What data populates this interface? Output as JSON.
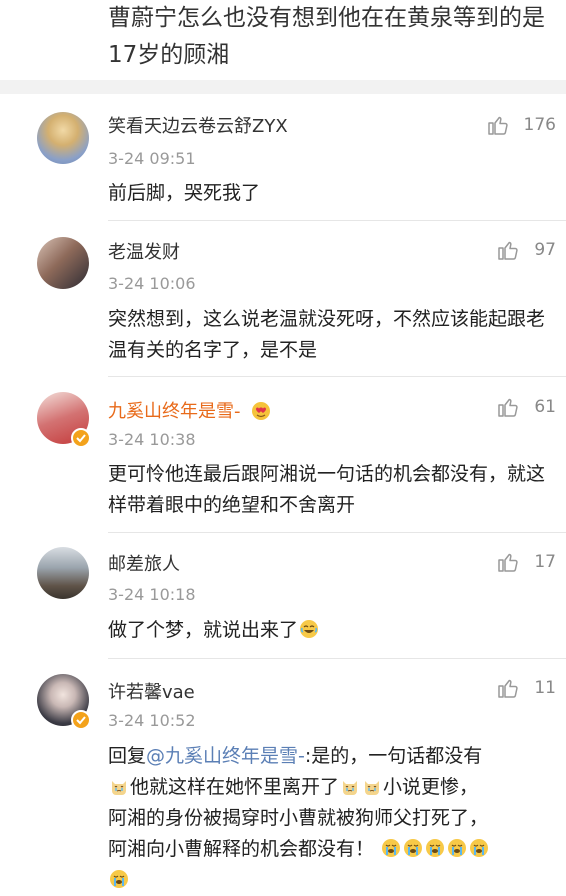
{
  "post": {
    "text": "曹蔚宁怎么也没有想到他在在黄泉等到的是17岁的顾湘"
  },
  "comments": [
    {
      "username": "笑看天边云卷云舒ZYX",
      "time": "3-24 09:51",
      "likes": "176",
      "text": "前后脚，哭死我了",
      "avatar_color": "#c9a86a"
    },
    {
      "username": "老温发财",
      "time": "3-24 10:06",
      "likes": "97",
      "text": "突然想到，这么说老温就没死呀，不然应该能起跟老温有关的名字了，是不是",
      "avatar_color": "#8c6a5a"
    },
    {
      "username": "九奚山终年是雪-",
      "time": "3-24 10:38",
      "likes": "61",
      "text": "更可怜他连最后跟阿湘说一句话的机会都没有，就这样带着眼中的绝望和不舍离开",
      "avatar_color": "#c25555",
      "vip": true
    },
    {
      "username": "邮差旅人",
      "time": "3-24 10:18",
      "likes": "17",
      "text": "做了个梦，就说出来了",
      "avatar_color": "#7a8b94"
    },
    {
      "username": "许若馨vae",
      "time": "3-24 10:52",
      "likes": "11",
      "reply_prefix": "回复",
      "mention": "@九奚山终年是雪-",
      "text_1": ":是的，一句话都没有",
      "text_2": "他就这样在她怀里离开了",
      "text_3": "小说更惨，",
      "text_4": "阿湘的身份被揭穿时小曹就被狗师父打死了，",
      "text_5": "阿湘向小曹解释的机会都没有！",
      "avatar_color": "#3b3b45",
      "verified": true
    }
  ],
  "colors": {
    "vip_name": "#e86a1a",
    "mention": "#5b7fb5",
    "muted": "#999999",
    "badge": "#f3a21b"
  },
  "icons": [
    "thumbs-up-icon",
    "crown-heart-emoji",
    "laugh-cry-emoji",
    "cat-cry-emoji",
    "sob-emoji"
  ]
}
